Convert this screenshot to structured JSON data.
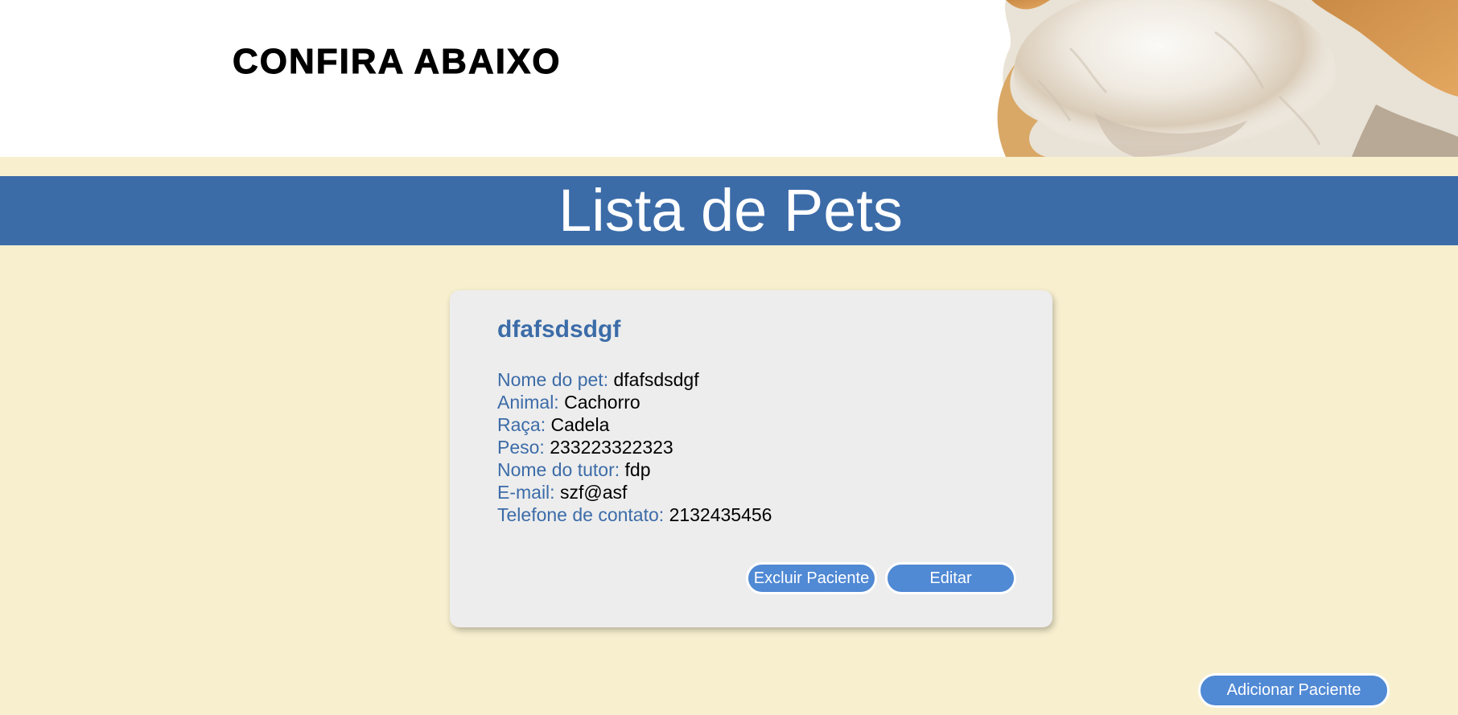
{
  "header": {
    "title": "CONFIRA ABAIXO"
  },
  "page": {
    "title": "Lista de Pets"
  },
  "card": {
    "name": "dfafsdsdgf",
    "fields": [
      {
        "label": "Nome do pet:",
        "value": "dfafsdsdgf"
      },
      {
        "label": "Animal:",
        "value": "Cachorro"
      },
      {
        "label": "Raça:",
        "value": "Cadela"
      },
      {
        "label": "Peso:",
        "value": "233223322323"
      },
      {
        "label": "Nome do tutor:",
        "value": "fdp"
      },
      {
        "label": "E-mail:",
        "value": "szf@asf"
      },
      {
        "label": "Telefone de contato:",
        "value": "2132435456"
      }
    ],
    "delete_label": "Excluir Paciente",
    "edit_label": "Editar"
  },
  "actions": {
    "add_label": "Adicionar Paciente"
  },
  "colors": {
    "accent": "#3c6ca8",
    "button": "#5089d4",
    "background": "#f7efce",
    "card": "#ededed"
  },
  "icons": {
    "header_image": "cat-fur-photo"
  }
}
